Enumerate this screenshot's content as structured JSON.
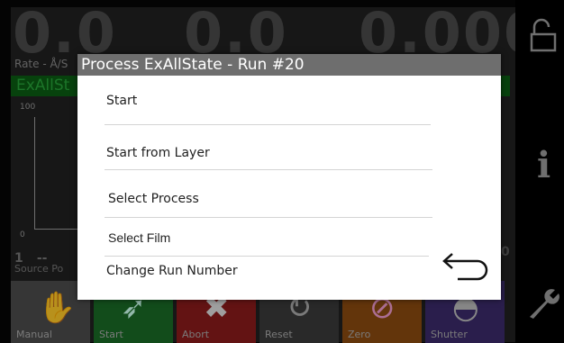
{
  "background": {
    "readouts": [
      "0.0",
      "0.0",
      "0.000"
    ],
    "rate_label": "Rate - Å/S",
    "process_label": "ExAllSt",
    "chart_ticks": [
      "100",
      "0"
    ],
    "source_number": "1",
    "source_dashes": "--",
    "source_label": "Source Po",
    "right_digit": "0",
    "tiles": [
      {
        "label": "Manual",
        "color": "#4c4c4c",
        "icon": "hand-icon"
      },
      {
        "label": "Start",
        "color": "#1a6a26",
        "icon": "runner-icon"
      },
      {
        "label": "Abort",
        "color": "#8a1b1b",
        "icon": "x-icon"
      },
      {
        "label": "Reset",
        "color": "#3a3a3a",
        "icon": "refresh-icon"
      },
      {
        "label": "Zero",
        "color": "#8a4a10",
        "icon": "zero-icon"
      },
      {
        "label": "Shutter",
        "color": "#3b2a6a",
        "icon": "shutter-icon"
      }
    ]
  },
  "dialog": {
    "title": "Process ExAllState - Run #20",
    "items": [
      {
        "label": "Start"
      },
      {
        "label": "Start from Layer"
      },
      {
        "label": "Select Process"
      },
      {
        "label": "Select Film"
      },
      {
        "label": "Change Run Number"
      }
    ],
    "back_icon": "back-arrow-icon"
  },
  "colors": {
    "header": "#6e6e6e",
    "accent_green": "#0b5c12"
  }
}
